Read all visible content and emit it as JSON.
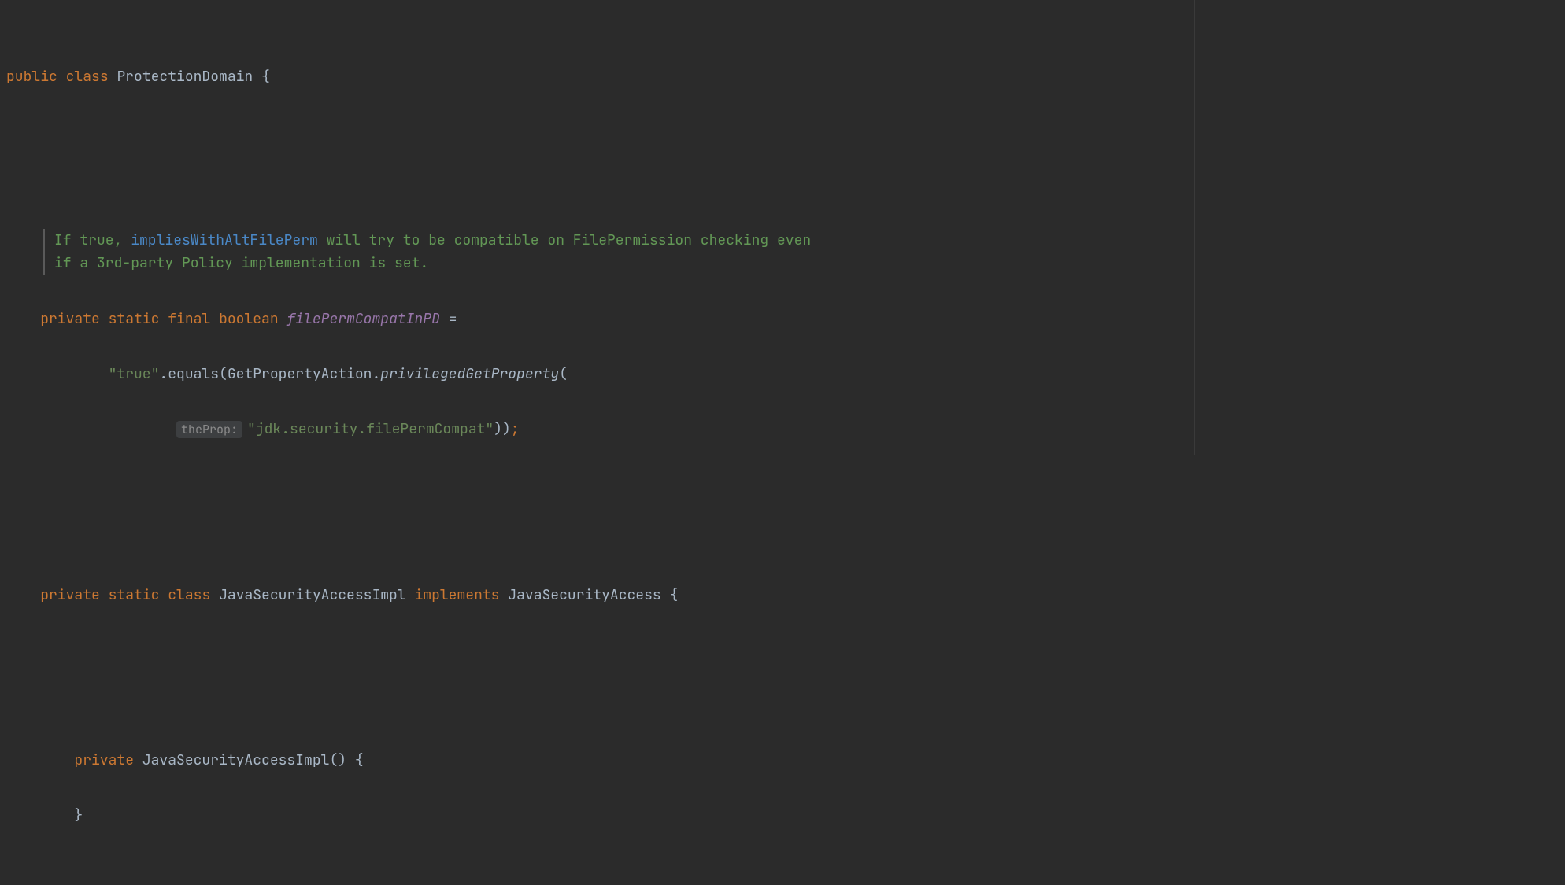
{
  "code": {
    "line1": {
      "kw_public": "public",
      "kw_class": "class",
      "classname": "ProtectionDomain",
      "brace": "{"
    },
    "doc": {
      "prefix": "If true, ",
      "link": "impliesWithAltFilePerm",
      "suffix": " will try to be compatible on FilePermission checking even if a 3rd-party Policy implementation is set."
    },
    "field_decl": {
      "kw_private": "private",
      "kw_static": "static",
      "kw_final": "final",
      "kw_boolean": "boolean",
      "field_name": "filePermCompatInPD",
      "equals": "="
    },
    "field_value": {
      "string_true": "\"true\"",
      "dot": ".",
      "equals_method": "equals",
      "lparen": "(",
      "class_ref": "GetPropertyAction",
      "method": "privilegedGetProperty",
      "lparen2": "("
    },
    "field_value2": {
      "param_hint": "theProp:",
      "string_prop": "\"jdk.security.filePermCompat\"",
      "close": "));"
    },
    "inner_class": {
      "kw_private": "private",
      "kw_static": "static",
      "kw_class": "class",
      "classname": "JavaSecurityAccessImpl",
      "kw_implements": "implements",
      "interface": "JavaSecurityAccess",
      "brace": "{"
    },
    "ctor": {
      "kw_private": "private",
      "name": "JavaSecurityAccessImpl",
      "parens": "()",
      "brace": "{",
      "close_brace": "}"
    }
  }
}
